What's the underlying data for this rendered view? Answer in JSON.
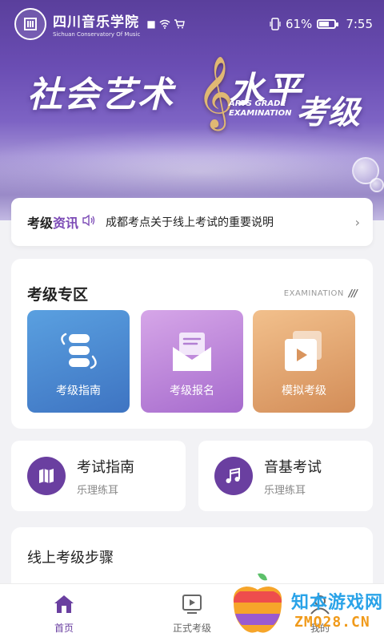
{
  "status_bar": {
    "school_name_cn": "四川音乐学院",
    "school_name_en": "Sichuan Conservatory Of Music",
    "battery": "61%",
    "time": "7:55"
  },
  "banner": {
    "title_left": "社会艺术",
    "title_right": "水平",
    "title_right2": "考级",
    "subtitle_en_1": "ARTS GRADE",
    "subtitle_en_2": "EXAMINATION",
    "clef_icon": "treble-clef-icon"
  },
  "news": {
    "tag_part1": "考级",
    "tag_part2": "资讯",
    "text": "成都考点关于线上考试的重要说明",
    "arrow": "›"
  },
  "zone": {
    "title": "考级专区",
    "title_en": "EXAMINATION",
    "tiles": [
      {
        "label": "考级指南",
        "icon": "guide-stack-icon"
      },
      {
        "label": "考级报名",
        "icon": "envelope-icon"
      },
      {
        "label": "模拟考级",
        "icon": "video-play-icon"
      }
    ]
  },
  "quick": [
    {
      "title": "考试指南",
      "sub": "乐理练耳",
      "icon": "map-icon"
    },
    {
      "title": "音基考试",
      "sub": "乐理练耳",
      "icon": "music-note-icon"
    }
  ],
  "steps": {
    "title": "线上考级步骤"
  },
  "nav": [
    {
      "label": "首页",
      "icon": "home-icon",
      "active": true
    },
    {
      "label": "正式考级",
      "icon": "play-screen-icon",
      "active": false
    },
    {
      "label": "我的",
      "icon": "user-icon",
      "active": false
    }
  ],
  "watermark": {
    "text": "知本游戏网",
    "url": "ZMQ28.CN"
  },
  "colors": {
    "accent": "#6a3fa0",
    "news_tag": "#7c4bb6",
    "tile_blue": "#4a86d0",
    "tile_purple": "#b87dd6",
    "tile_orange": "#e0a56e"
  }
}
